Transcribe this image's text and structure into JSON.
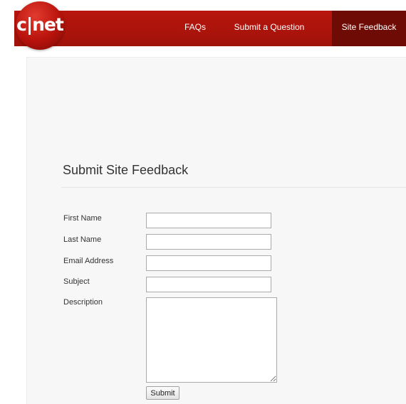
{
  "header": {
    "logo_text": "c|net",
    "nav": {
      "faqs": "FAQs",
      "submit_question": "Submit a Question",
      "site_feedback": "Site Feedback"
    },
    "brand_color": "#b8160d",
    "active_tab_color": "#6e0b05"
  },
  "main": {
    "title": "Submit Site Feedback",
    "form": {
      "first_name_label": "First Name",
      "first_name_value": "",
      "last_name_label": "Last Name",
      "last_name_value": "",
      "email_label": "Email Address",
      "email_value": "",
      "subject_label": "Subject",
      "subject_value": "",
      "description_label": "Description",
      "description_value": "",
      "submit_label": "Submit"
    }
  }
}
